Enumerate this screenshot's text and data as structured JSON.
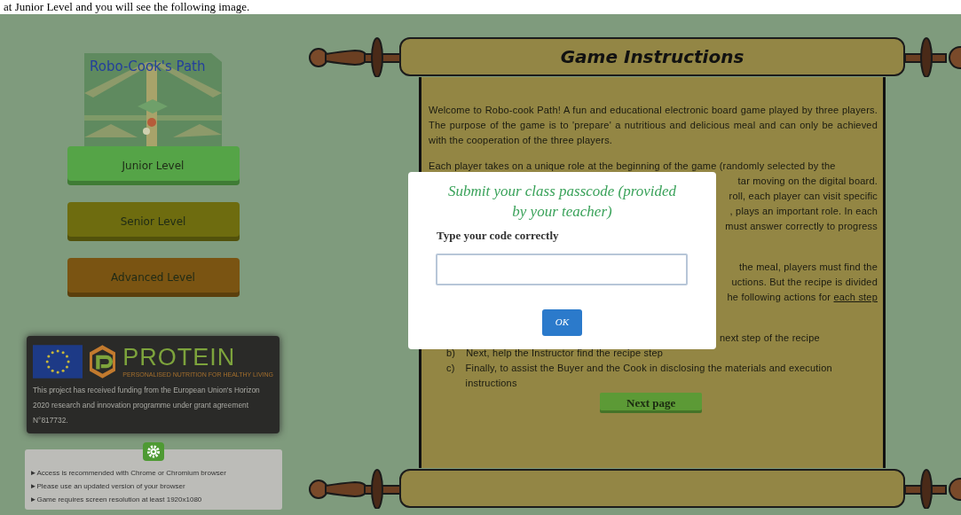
{
  "document_caption": "at Junior Level and you will see the following image.",
  "game_logo": {
    "title": "Robo-Cook's Path",
    "kind": "picture"
  },
  "levels": [
    {
      "label": "Junior Level",
      "color": "#55a447"
    },
    {
      "label": "Senior Level",
      "color": "#6e6c0f"
    },
    {
      "label": "Advanced Level",
      "color": "#7a5412"
    }
  ],
  "funding": {
    "brand": "PROTEIN",
    "tagline": "PERSONALISED NUTRITION FOR HEALTHY LIVING",
    "text": "This project has received funding from the European Union's Horizon 2020 research and innovation programme under grant agreement N°817732."
  },
  "notices": [
    "►Access is recommended with Chrome or Chromium browser",
    "►Please use an updated version of your browser",
    "►Game requires screen resolution at least 1920x1080"
  ],
  "instructions": {
    "title": "Game Instructions",
    "intro": "Welcome to Robo-cook Path! A fun and educational electronic board game played by three players. The purpose of the game is to 'prepare' a nutritious and delicious meal and can only be achieved with the cooperation of the three players.",
    "lines": [
      {
        "kind": "full",
        "text": "Each player takes on a unique role at the beginning of the game (randomly selected by the"
      },
      {
        "kind": "end",
        "text": "tar moving on the digital board."
      },
      {
        "kind": "end",
        "text": "roll, each player can visit specific"
      },
      {
        "kind": "end",
        "text": ", plays an important role. In each"
      },
      {
        "kind": "end",
        "text": "must answer correctly to progress"
      },
      {
        "kind": "gap"
      },
      {
        "kind": "end",
        "text": "the meal, players must find the"
      },
      {
        "kind": "end",
        "text": "uctions. But the recipe is divided"
      },
      {
        "kind": "end",
        "text": "he following actions for",
        "underlined": "each step"
      },
      {
        "kind": "gap"
      },
      {
        "kind": "start",
        "text": "next step of the recipe"
      }
    ],
    "list": [
      {
        "marker": "b)",
        "text": "Next, help the Instructor find the recipe step"
      },
      {
        "marker": "c)",
        "text": "Finally, to assist the Buyer and the Cook in disclosing the materials and execution instructions"
      }
    ],
    "next_button": "Next page"
  },
  "dialog": {
    "title": "Submit your class passcode (provided by your teacher)",
    "label": "Type your code correctly",
    "button": "OK"
  }
}
